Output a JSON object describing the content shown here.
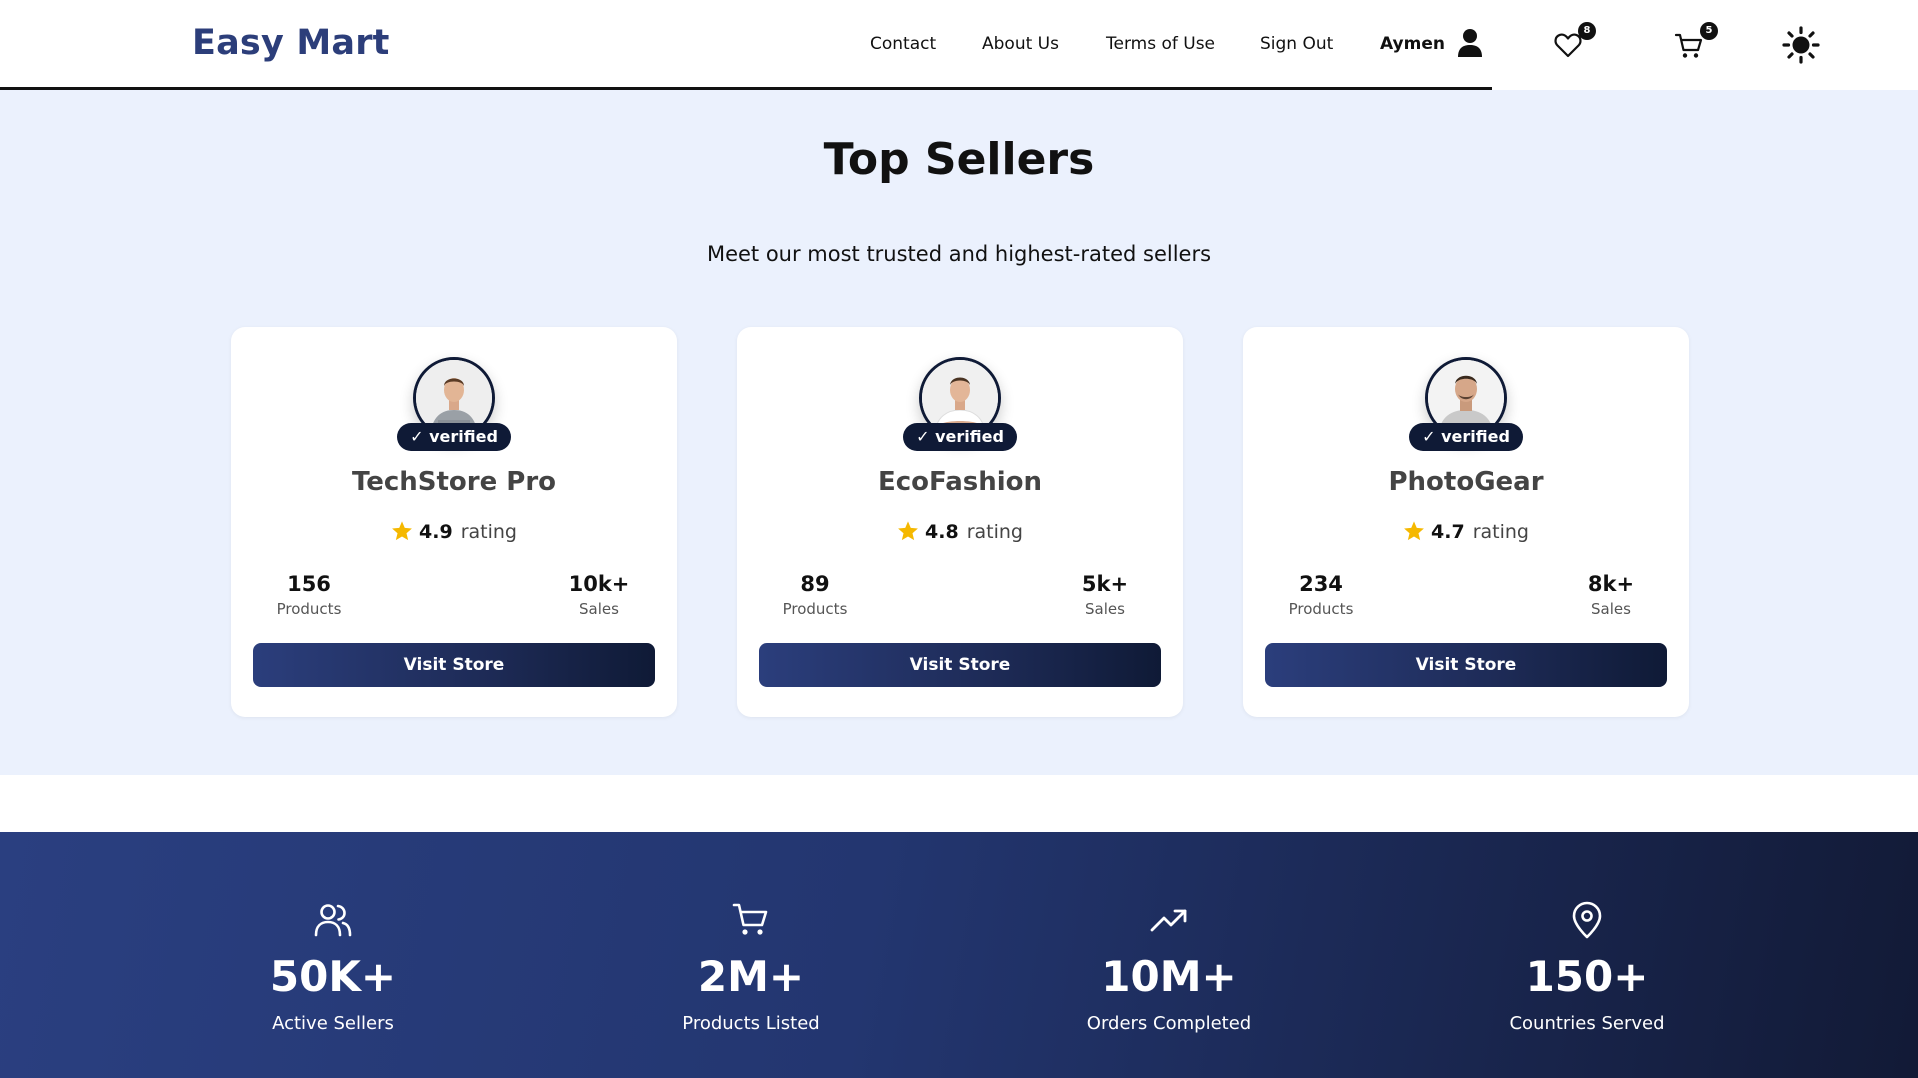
{
  "header": {
    "logo": "Easy Mart",
    "nav": [
      "Contact",
      "About Us",
      "Terms of Use",
      "Sign Out"
    ],
    "user_name": "Aymen",
    "wishlist_count": "8",
    "cart_count": "5",
    "icons": [
      "user-icon",
      "heart-icon",
      "cart-icon",
      "sun-icon"
    ]
  },
  "top_sellers": {
    "title": "Top Sellers",
    "subtitle": "Meet our most trusted and highest-rated sellers",
    "verified_label": "✓ verified",
    "rating_label": "rating",
    "products_label": "Products",
    "sales_label": "Sales",
    "button_label": "Visit Store",
    "sellers": [
      {
        "name": "TechStore Pro",
        "rating": "4.9",
        "products": "156",
        "sales": "10k+"
      },
      {
        "name": "EcoFashion",
        "rating": "4.8",
        "products": "89",
        "sales": "5k+"
      },
      {
        "name": "PhotoGear",
        "rating": "4.7",
        "products": "234",
        "sales": "8k+"
      }
    ]
  },
  "stats": [
    {
      "icon": "users-icon",
      "value": "50K+",
      "label": "Active Sellers"
    },
    {
      "icon": "cart-icon",
      "value": "2M+",
      "label": "Products Listed"
    },
    {
      "icon": "trending-up-icon",
      "value": "10M+",
      "label": "Orders Completed"
    },
    {
      "icon": "map-pin-icon",
      "value": "150+",
      "label": "Countries Served"
    }
  ],
  "colors": {
    "brand": "#2c3e7a",
    "section_bg": "#ebf1fd",
    "dark_navy": "#0f1a36",
    "star": "#f5b800"
  }
}
